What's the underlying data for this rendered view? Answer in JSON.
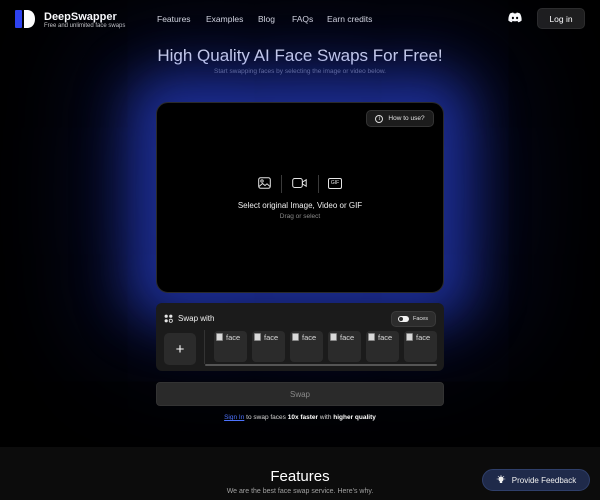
{
  "brand": {
    "name": "DeepSwapper",
    "tagline": "Free and unlimited face swaps"
  },
  "nav": {
    "links": [
      "Features",
      "Examples",
      "Blog",
      "FAQs",
      "Earn credits"
    ],
    "login_label": "Log in"
  },
  "hero": {
    "title": "High Quality AI Face Swaps For Free!",
    "subtitle": "Start swapping faces by selecting the image or video below."
  },
  "upload": {
    "how_to_label": "How to use?",
    "gif_label": "GIF",
    "title": "Select original Image, Video or GIF",
    "subtitle": "Drag or select"
  },
  "swap_with": {
    "label": "Swap with",
    "toggle_label": "Faces",
    "add_label": "+",
    "face_alts": [
      "face",
      "face",
      "face",
      "face",
      "face",
      "face"
    ]
  },
  "swap_button": {
    "label": "Swap"
  },
  "signin": {
    "link": "Sign In",
    "mid": "to swap faces",
    "bold1": "10x faster",
    "mid2": "with",
    "bold2": "higher quality"
  },
  "features": {
    "title": "Features",
    "subtitle": "We are the best face swap service. Here's why."
  },
  "feedback": {
    "label": "Provide Feedback"
  },
  "colors": {
    "background": "#000000",
    "accent_glow": "#2e48e6",
    "link": "#4d73ff",
    "logo_blue": "#2f43f0"
  }
}
